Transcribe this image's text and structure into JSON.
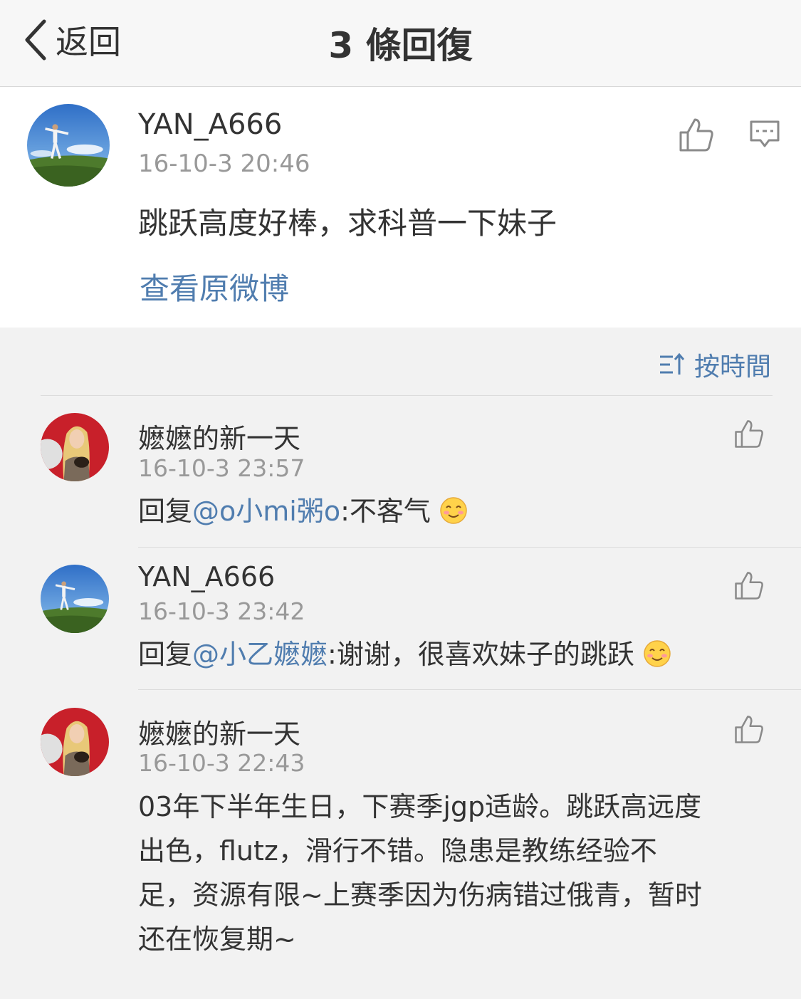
{
  "nav": {
    "back_label": "返回",
    "title": "3 條回復"
  },
  "main_comment": {
    "username": "YAN_A666",
    "time": "16-10-3 20:46",
    "text": "跳跃高度好棒，求科普一下妹子",
    "view_original": "查看原微博"
  },
  "sort": {
    "label": "按時間"
  },
  "replies": [
    {
      "username": "嬷嬷的新一天",
      "time": "16-10-3 23:57",
      "prefix": "回复",
      "mention": "@o小mi粥o",
      "text": ":不客气"
    },
    {
      "username": "YAN_A666",
      "time": "16-10-3 23:42",
      "prefix": "回复",
      "mention": "@小乙嬷嬷",
      "text": ":谢谢，很喜欢妹子的跳跃"
    },
    {
      "username": "嬷嬷的新一天",
      "time": "16-10-3 22:43",
      "text_lines": [
        "03年下半年生日，下赛季jgp适龄。跳跃高远度",
        "出色，flutz，滑行不错。隐患是教练经验不",
        "足，资源有限~上赛季因为伤病错过俄青，暂时",
        "还在恢复期~"
      ]
    }
  ],
  "colors": {
    "link": "#507daf",
    "text": "#333333",
    "muted": "#999999",
    "background": "#f2f2f2"
  }
}
